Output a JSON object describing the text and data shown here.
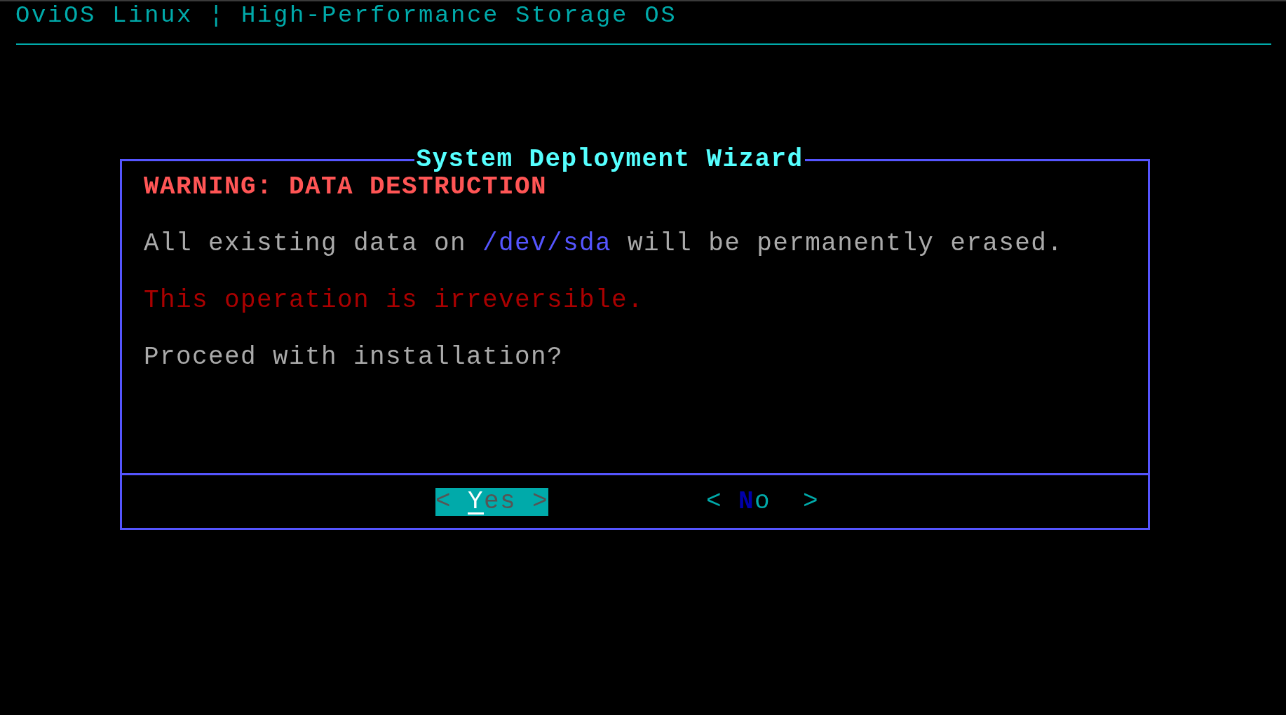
{
  "header": {
    "title": "OviOS Linux ¦ High-Performance Storage OS"
  },
  "dialog": {
    "title": "System Deployment Wizard",
    "lines": [
      {
        "kind": "warning",
        "segments": [
          {
            "kind": "plain",
            "text": "WARNING: DATA DESTRUCTION"
          }
        ]
      },
      {
        "kind": "body",
        "segments": [
          {
            "kind": "plain",
            "text": "All existing data on "
          },
          {
            "kind": "device",
            "text": "/dev/sda"
          },
          {
            "kind": "plain",
            "text": " will be permanently erased."
          }
        ]
      },
      {
        "kind": "alert",
        "segments": [
          {
            "kind": "plain",
            "text": "This operation is irreversible."
          }
        ]
      },
      {
        "kind": "body",
        "segments": [
          {
            "kind": "plain",
            "text": "Proceed with installation?"
          }
        ]
      }
    ],
    "buttons": [
      {
        "label": "Yes",
        "open": "<",
        "close": ">",
        "selected": true
      },
      {
        "label": "No",
        "open": "<",
        "close": ">",
        "selected": false
      }
    ]
  }
}
